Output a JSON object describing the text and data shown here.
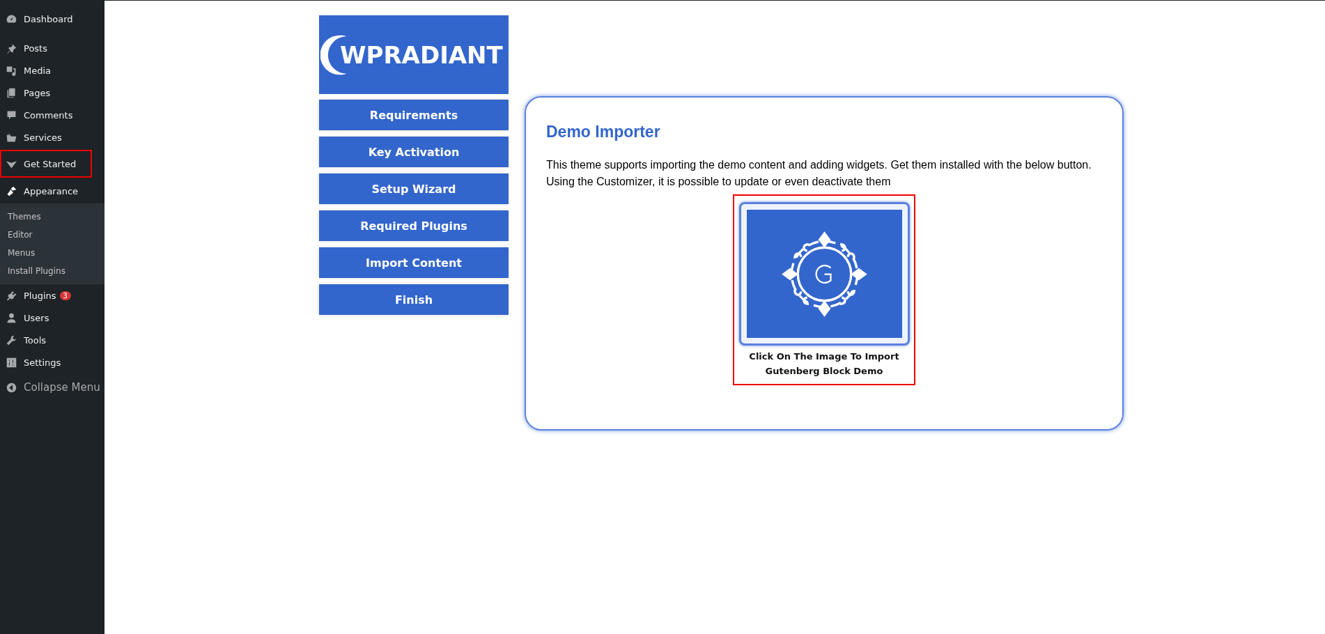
{
  "sidebar": {
    "items": [
      {
        "label": "Dashboard",
        "highlighted": false
      },
      {
        "label": "Posts",
        "highlighted": false
      },
      {
        "label": "Media",
        "highlighted": false
      },
      {
        "label": "Pages",
        "highlighted": false
      },
      {
        "label": "Comments",
        "highlighted": false
      },
      {
        "label": "Services",
        "highlighted": false
      },
      {
        "label": "Get Started",
        "highlighted": true
      },
      {
        "label": "Appearance",
        "highlighted": false,
        "expanded": true,
        "children": [
          {
            "label": "Themes"
          },
          {
            "label": "Editor"
          },
          {
            "label": "Menus"
          },
          {
            "label": "Install Plugins"
          }
        ]
      },
      {
        "label": "Plugins",
        "highlighted": false,
        "badge": "3"
      },
      {
        "label": "Users",
        "highlighted": false
      },
      {
        "label": "Tools",
        "highlighted": false
      },
      {
        "label": "Settings",
        "highlighted": false
      }
    ],
    "collapse": "Collapse Menu"
  },
  "logo": {
    "text": "WPRADIANT"
  },
  "steps": [
    {
      "label": "Requirements"
    },
    {
      "label": "Key Activation"
    },
    {
      "label": "Setup Wizard"
    },
    {
      "label": "Required Plugins"
    },
    {
      "label": "Import Content"
    },
    {
      "label": "Finish"
    }
  ],
  "panel": {
    "title": "Demo Importer",
    "text": "This theme supports importing the demo content and adding widgets. Get them installed with the below button. Using the Customizer, it is possible to update or even deactivate them",
    "demo": {
      "caption": "Click On The Image To Import Gutenberg Block Demo",
      "highlighted": true
    }
  }
}
